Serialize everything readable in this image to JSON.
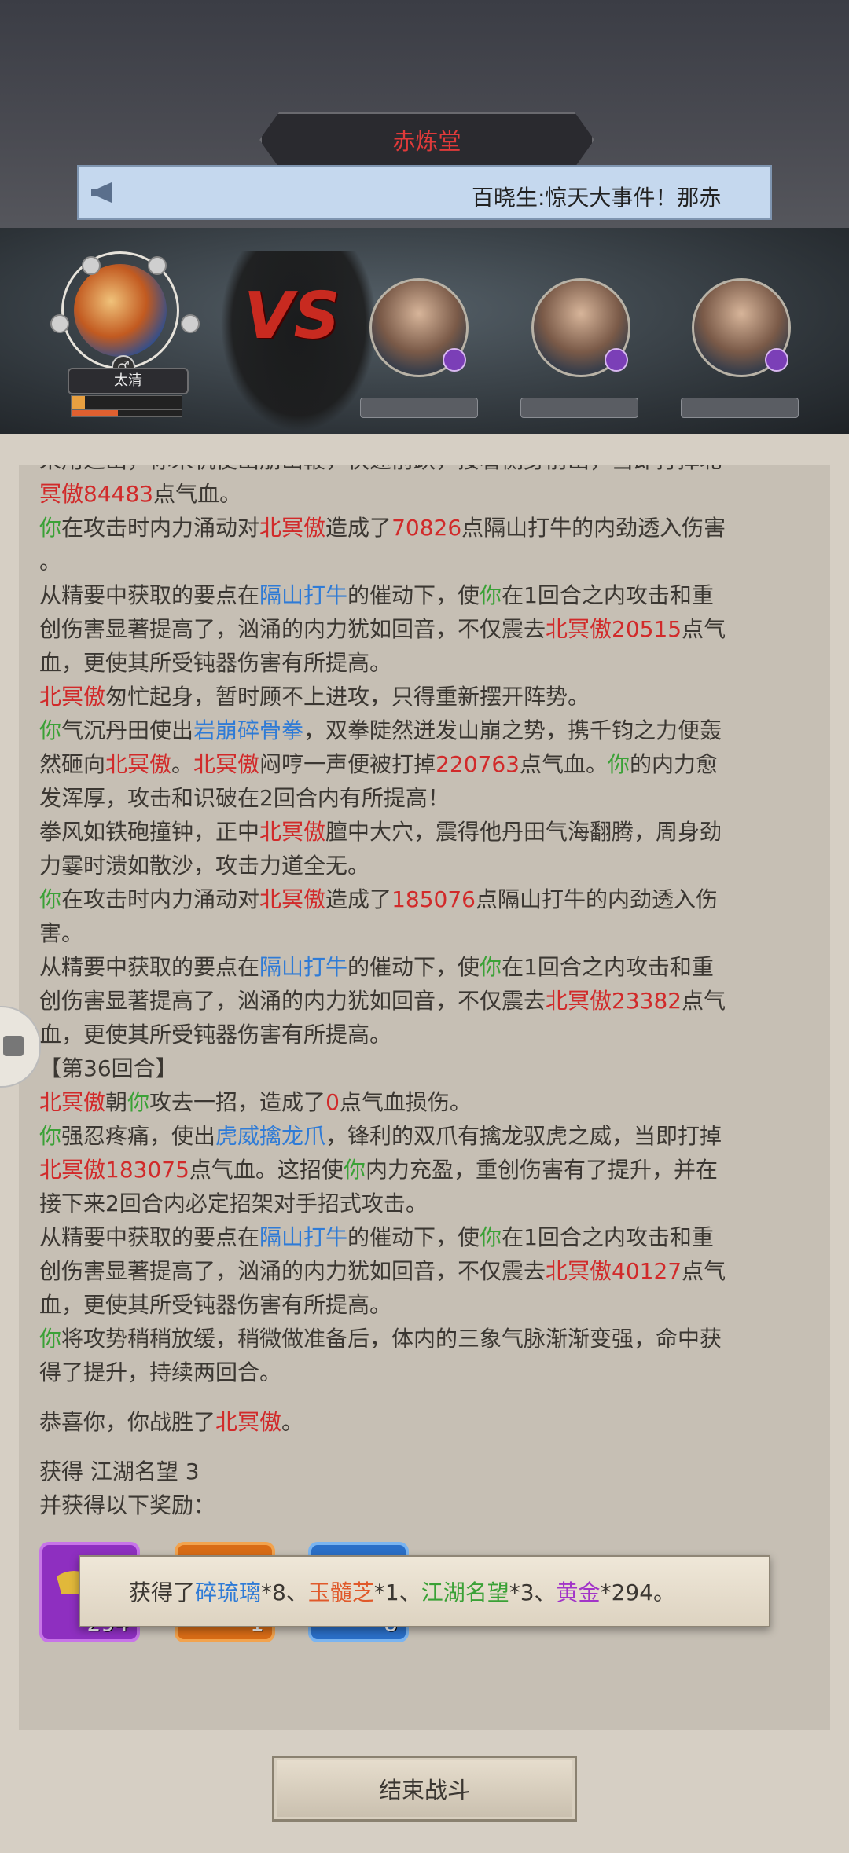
{
  "header": {
    "location_title": "赤炼堂",
    "marquee_text": "百晓生:惊天大事件！那赤"
  },
  "battle": {
    "player_name": "太清",
    "player_gender": "♂",
    "vs_label": "VS",
    "enemies": [
      {
        "portrait": "enemy-1"
      },
      {
        "portrait": "enemy-2"
      },
      {
        "portrait": "enemy-3"
      }
    ]
  },
  "log": {
    "line0": "采用适出，你末机使出崩山鞭，快速前跃，接着侧身前出，当即打掉北",
    "l1a": "冥傲",
    "l1b": "84483",
    "l1c": "点气血。",
    "l2a": "你",
    "l2b": "在攻击时内力涌动对",
    "l2c": "北冥傲",
    "l2d": "造成了",
    "l2e": "70826",
    "l2f": "点隔山打牛的内劲透入伤害",
    "l3": "。",
    "l4a": "从精要中获取的要点在",
    "l4b": "隔山打牛",
    "l4c": "的催动下，使",
    "l4d": "你",
    "l4e": "在1回合之内攻击和重",
    "l5a": "创伤害显著提高了，汹涌的内力犹如回音，不仅震去",
    "l5b": "北冥傲",
    "l5c": "20515",
    "l5d": "点气",
    "l6": "血，更使其所受钝器伤害有所提高。",
    "l7a": "北冥傲",
    "l7b": "匆忙起身，暂时顾不上进攻，只得重新摆开阵势。",
    "l8a": "你",
    "l8b": "气沉丹田使出",
    "l8c": "岩崩碎骨拳",
    "l8d": "，双拳陡然迸发山崩之势，携千钧之力便轰",
    "l9a": "然砸向",
    "l9b": "北冥傲",
    "l9c": "。",
    "l9d": "北冥傲",
    "l9e": "闷哼一声便被打掉",
    "l9f": "220763",
    "l9g": "点气血。",
    "l9h": "你",
    "l9i": "的内力愈",
    "l10": "发浑厚，攻击和识破在2回合内有所提高！",
    "l11a": "拳风如铁砲撞钟，正中",
    "l11b": "北冥傲",
    "l11c": "膻中大穴，震得他丹田气海翻腾，周身劲",
    "l12": "力霎时溃如散沙，攻击力道全无。",
    "l13a": "你",
    "l13b": "在攻击时内力涌动对",
    "l13c": "北冥傲",
    "l13d": "造成了",
    "l13e": "185076",
    "l13f": "点隔山打牛的内劲透入伤",
    "l14": "害。",
    "l15a": "从精要中获取的要点在",
    "l15b": "隔山打牛",
    "l15c": "的催动下，使",
    "l15d": "你",
    "l15e": "在1回合之内攻击和重",
    "l16a": "创伤害显著提高了，汹涌的内力犹如回音，不仅震去",
    "l16b": "北冥傲",
    "l16c": "23382",
    "l16d": "点气",
    "l17": "血，更使其所受钝器伤害有所提高。",
    "l18": "【第36回合】",
    "l19a": "北冥傲",
    "l19b": "朝",
    "l19c": "你",
    "l19d": "攻去一招，造成了",
    "l19e": "0",
    "l19f": "点气血损伤。",
    "l20a": "你",
    "l20b": "强忍疼痛，使出",
    "l20c": "虎威擒龙爪",
    "l20d": "，锋利的双爪有擒龙驭虎之威，当即打掉",
    "l21a": "北冥傲",
    "l21b": "183075",
    "l21c": "点气血。这招使",
    "l21d": "你",
    "l21e": "内力充盈，重创伤害有了提升，并在",
    "l22": "接下来2回合内必定招架对手招式攻击。",
    "l23a": "从精要中获取的要点在",
    "l23b": "隔山打牛",
    "l23c": "的催动下，使",
    "l23d": "你",
    "l23e": "在1回合之内攻击和重",
    "l24a": "创伤害显著提高了，汹涌的内力犹如回音，不仅震去",
    "l24b": "北冥傲",
    "l24c": "40127",
    "l24d": "点气",
    "l25": "血，更使其所受钝器伤害有所提高。",
    "l26a": "你",
    "l26b": "将攻势稍稍放缓，稍微做准备后，体内的三象气脉渐渐变强，命中获",
    "l27": "得了提升，持续两回合。",
    "l28a": "恭喜你，你战胜了",
    "l28b": "北冥傲",
    "l28c": "。",
    "l29": "获得 江湖名望 3",
    "l30": "并获得以下奖励："
  },
  "rewards": [
    {
      "icon": "gold-ingot-icon",
      "count": "294",
      "color": "#a33ad0"
    },
    {
      "icon": "orange-item-icon",
      "count": "1",
      "color": "#e07a22"
    },
    {
      "icon": "blue-item-icon",
      "count": "8",
      "color": "#2f7bd6"
    }
  ],
  "toast": {
    "prefix": "获得了",
    "i1": "碎琉璃",
    "q1": "*8、",
    "i2": "玉髓芝",
    "q2": "*1、",
    "i3": "江湖名望",
    "q3": "*3、",
    "i4": "黄金",
    "q4": "*294。"
  },
  "end_button": "结束战斗"
}
